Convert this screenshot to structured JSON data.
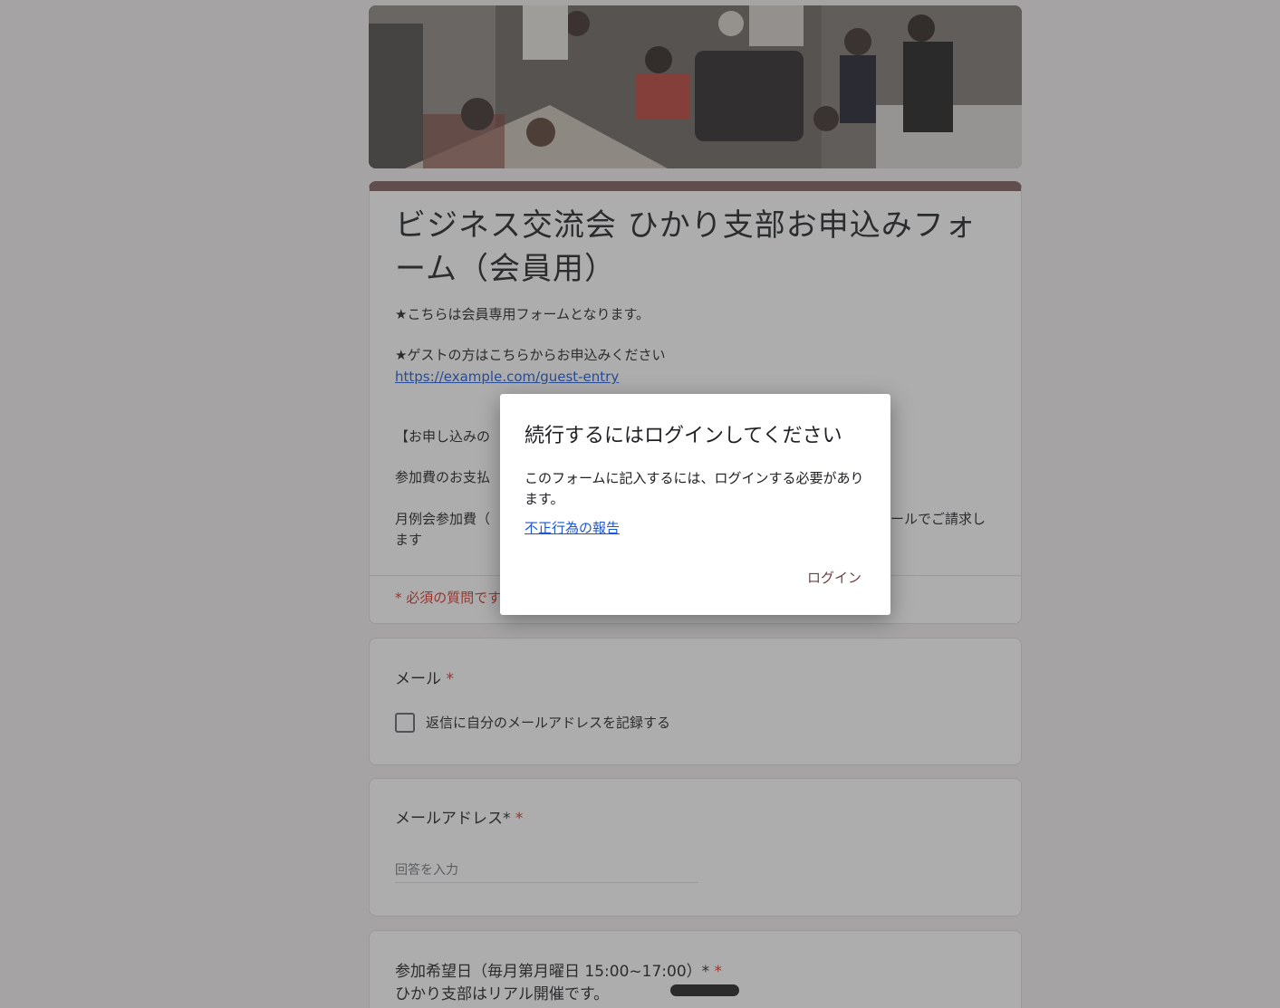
{
  "form": {
    "title": "ビジネス交流会 ひかり支部お申込みフォーム（会員用）",
    "description": {
      "line1": "★こちらは会員専用フォームとなります。",
      "line2": "★ゲストの方はこちらからお申込みください",
      "guest_link": "https://example.com/guest-entry",
      "line3": "【お申し込みの",
      "line4": "参加費のお支払",
      "line5_left": "月例会参加費（",
      "line5_right": "ールでご請求し",
      "line6": "ます"
    },
    "required_note": "* 必須の質問です"
  },
  "questions": {
    "email": {
      "label": "メール",
      "required_mark": "*",
      "checkbox_label": "返信に自分のメールアドレスを記録する"
    },
    "email_address": {
      "label": "メールアドレス*",
      "required_mark": "*",
      "placeholder": "回答を入力"
    },
    "date": {
      "label": "参加希望日（毎月第月曜日 15:00~17:00）*",
      "required_mark": "*",
      "sub_text": "ひかり支部はリアル開催です。"
    }
  },
  "dialog": {
    "title": "続行するにはログインしてください",
    "body": "このフォームに記入するには、ログインする必要があります。",
    "report_link": "不正行為の報告",
    "login_button": "ログイン"
  },
  "colors": {
    "accent": "#7a5a5a",
    "required": "#d93025",
    "link": "#1a57d6",
    "overlay": "rgba(60,60,60,0.42)"
  }
}
